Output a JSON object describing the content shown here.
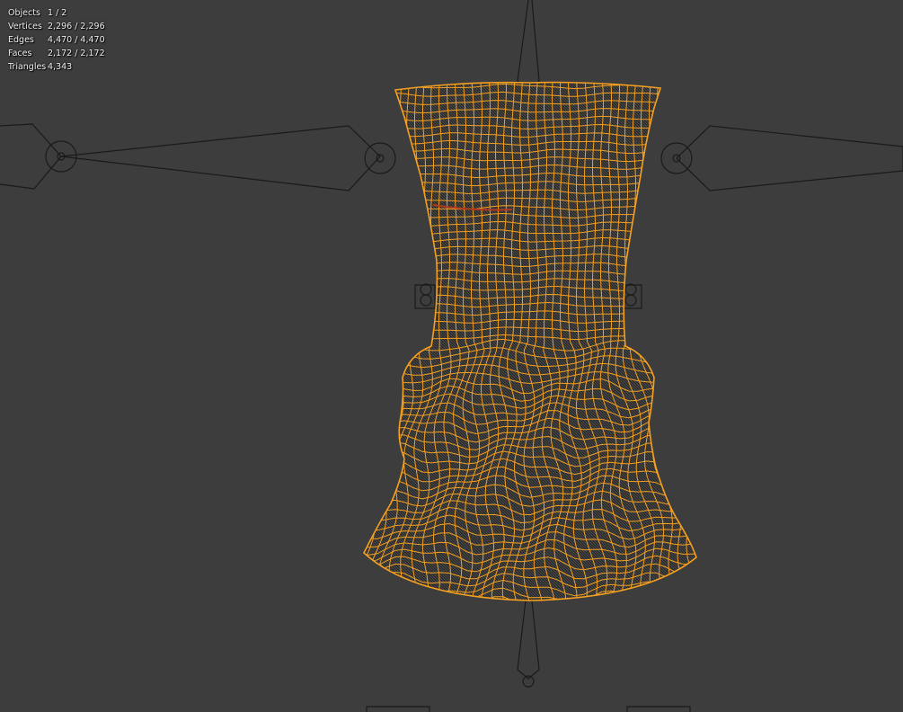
{
  "viewport": {
    "background": "#3d3d3d",
    "selection_color": "#f5a020",
    "armature_color": "#1a1a1a",
    "accent_red": "#b33a1f"
  },
  "stats": {
    "objects": {
      "label": "Objects",
      "value": "1 / 2"
    },
    "vertices": {
      "label": "Vertices",
      "value": "2,296 / 2,296"
    },
    "edges": {
      "label": "Edges",
      "value": "4,470 / 4,470"
    },
    "faces": {
      "label": "Faces",
      "value": "2,172 / 2,172"
    },
    "triangles": {
      "label": "Triangles",
      "value": "4,343"
    }
  },
  "scene": {
    "selected_object": "dress-mesh-wireframe",
    "armature": "rig-bones"
  }
}
